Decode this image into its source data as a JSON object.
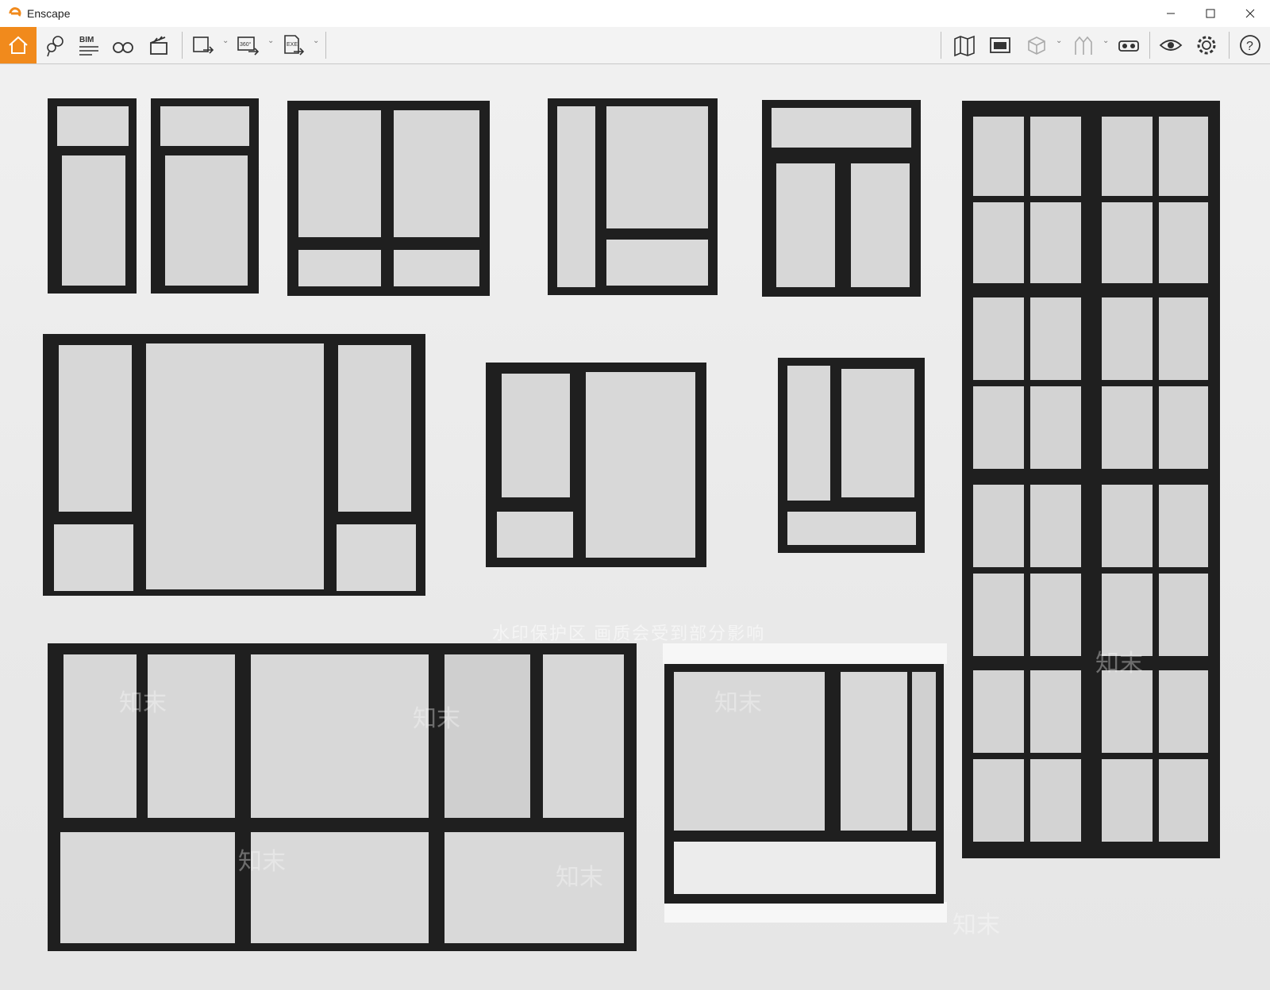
{
  "window": {
    "title": "Enscape"
  },
  "toolbar": {
    "bim_label": "BIM",
    "export_360_label": "360°",
    "export_exe_label": "EXE"
  },
  "watermark": {
    "text": "水印保护区   画质会受到部分影响",
    "brand": "知末"
  },
  "colors": {
    "accent": "#f18a1c",
    "frame": "#1f1f1f",
    "glass": "#d8d8d8"
  },
  "scene": {
    "description_items": [
      "window-1",
      "window-2",
      "window-3",
      "window-4",
      "window-5",
      "window-6",
      "window-7",
      "window-8",
      "window-9",
      "window-10",
      "window-11"
    ]
  }
}
